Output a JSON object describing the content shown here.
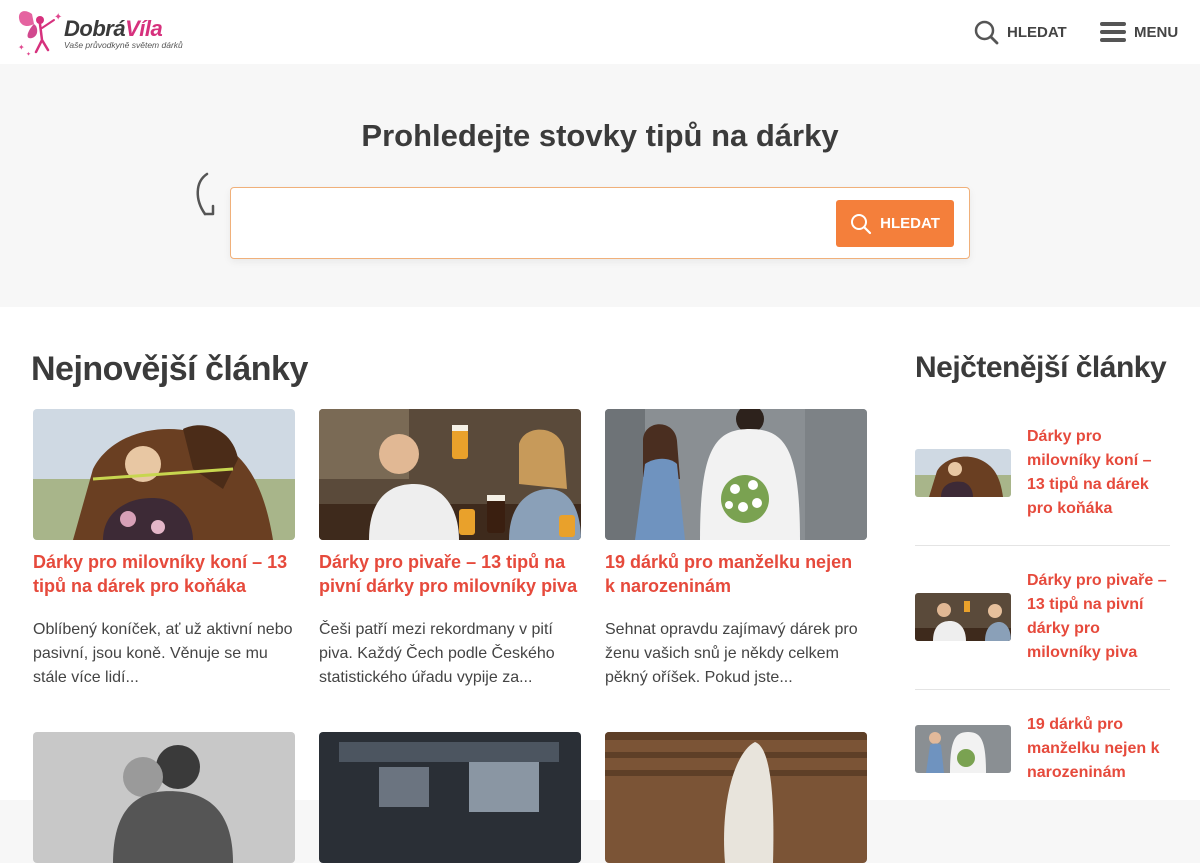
{
  "header": {
    "logo_word1": "Dobrá",
    "logo_word2": "Víla",
    "logo_tagline": "Vaše průvodkyně světem dárků",
    "search_label": "HLEDAT",
    "menu_label": "MENU",
    "search_icon": "search-icon",
    "menu_icon": "hamburger-icon"
  },
  "hero": {
    "title": "Prohledejte stovky tipů na dárky",
    "search_value": "",
    "search_button": "HLEDAT"
  },
  "latest": {
    "title": "Nejnovější články",
    "articles": [
      {
        "title": "Dárky pro milovníky koní – 13 tipů na dárek pro koňáka",
        "excerpt": "Oblíbený koníček, ať už aktivní nebo pasivní, jsou koně. Věnuje se mu stále více lidí..."
      },
      {
        "title": "Dárky pro pivaře – 13 tipů na pivní dárky pro milovníky piva",
        "excerpt": "Češi patří mezi rekordmany v pití piva. Každý Čech podle Českého statistického úřadu vypije za..."
      },
      {
        "title": "19 dárků pro manželku nejen k narozeninám",
        "excerpt": "Sehnat opravdu zajímavý dárek pro ženu vašich snů je někdy celkem pěkný oříšek. Pokud jste..."
      }
    ]
  },
  "popular": {
    "title": "Nejčtenější články",
    "articles": [
      {
        "title": "Dárky pro milovníky koní – 13 tipů na dárek pro koňáka"
      },
      {
        "title": "Dárky pro pivaře – 13 tipů na pivní dárky pro milovníky piva"
      },
      {
        "title": "19 dárků pro manželku nejen k narozeninám"
      }
    ]
  },
  "colors": {
    "accent_orange": "#f47f3b",
    "title_red": "#e64a3c",
    "logo_pink": "#d6317d"
  }
}
